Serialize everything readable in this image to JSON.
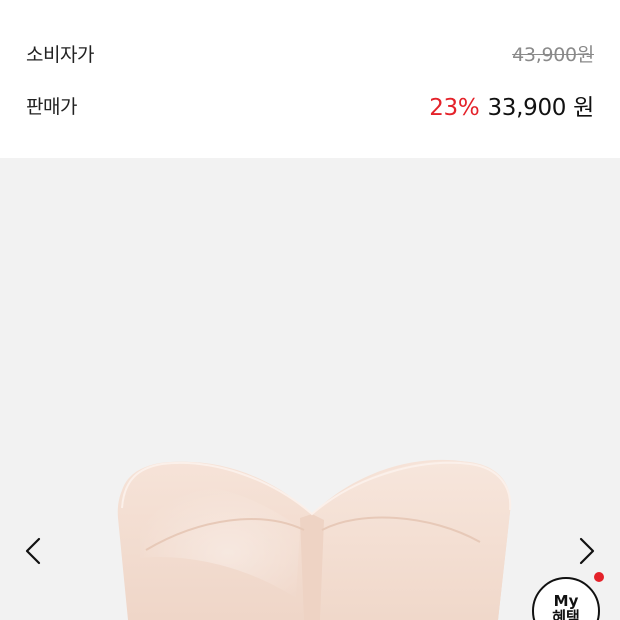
{
  "price": {
    "consumer_label": "소비자가",
    "consumer_price": "43,900원",
    "sale_label": "판매가",
    "discount_rate": "23%",
    "sale_price": "33,900 원"
  },
  "gallery": {
    "prev_icon": "chevron-left-icon",
    "next_icon": "chevron-right-icon"
  },
  "floating_button": {
    "line1": "My",
    "line2": "혜택"
  },
  "colors": {
    "discount": "#e4222a",
    "gallery_background": "#f2f2f2",
    "product": "#f3dccf"
  }
}
